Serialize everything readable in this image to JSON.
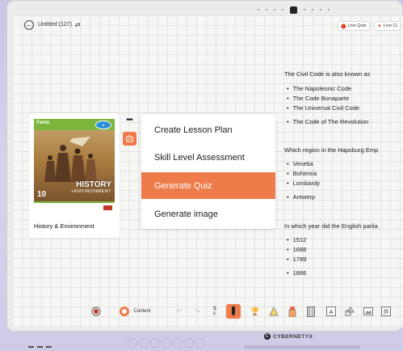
{
  "window": {
    "title": "Untitled (127)",
    "live_quiz_label": "Live Quiz",
    "live_class_label": "Live Cl",
    "accent_color": "#ee7c4b"
  },
  "book": {
    "cover_brand": "Fanta",
    "cover_title": "HISTORY",
    "cover_subtitle": "+ENVIRONMENT",
    "cover_grade": "10",
    "label": "History & Environment"
  },
  "menu": {
    "items": [
      {
        "label": "Create Lesson Plan"
      },
      {
        "label": "Skill Level Assessment"
      },
      {
        "label": "Generate Quiz"
      },
      {
        "label": "Generate image"
      }
    ],
    "more_label": "•••",
    "active_index": 2
  },
  "quiz": {
    "questions": [
      {
        "text": "The Civil Code is also known as",
        "options": [
          "The Napoleonic Code",
          "The Code Bonaparte",
          "The Universal Civil Code",
          "The Code of The Revolution"
        ]
      },
      {
        "text": "Which region in the Hapsburg Emp",
        "options": [
          "Venetia",
          "Bohemia",
          "Lombardy",
          "Antwerp"
        ]
      },
      {
        "text": "In which year did the English parlia",
        "options": [
          "1512",
          "1688",
          "1789",
          "1866"
        ]
      }
    ]
  },
  "toolbar": {
    "content_label": "Content",
    "icons": [
      "record-icon",
      "content-icon",
      "undo-icon",
      "redo-icon",
      "layers-icon",
      "pen-icon",
      "trophy-icon",
      "triangle-icon",
      "marker-icon",
      "film-icon",
      "text-icon",
      "shapes-icon",
      "image-icon"
    ]
  },
  "device": {
    "brand": "CYBERNETYX"
  }
}
